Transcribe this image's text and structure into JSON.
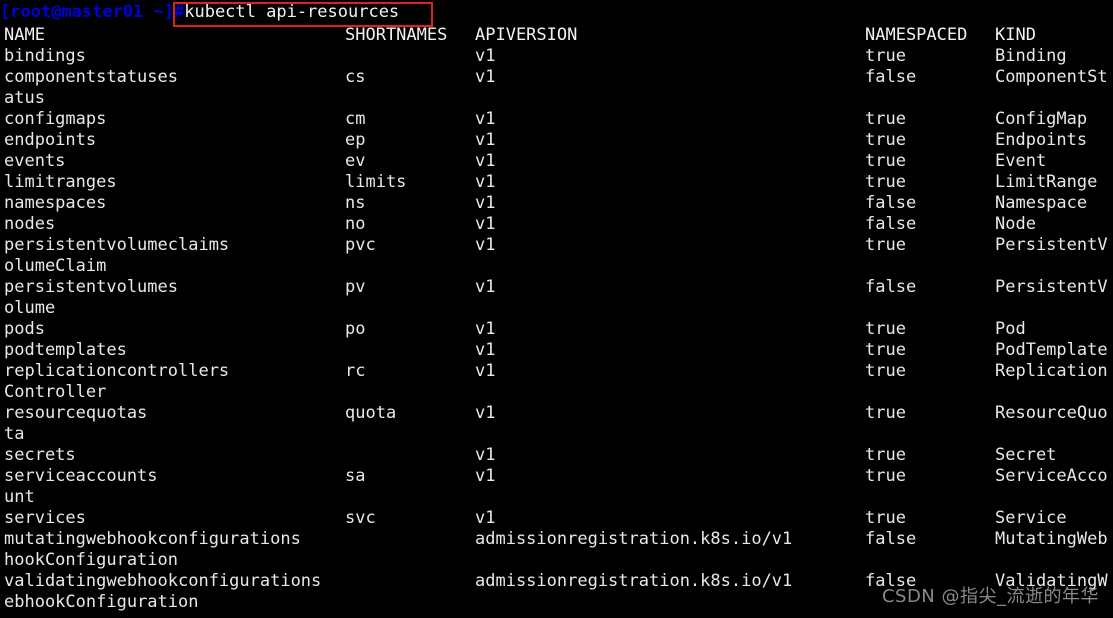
{
  "terminal": {
    "background_color": "#000000",
    "foreground_color": "#e8e8e8",
    "prompt_color": "#0000d8",
    "highlight_box_color": "#e02020",
    "prompt": "[root@master01 ~]#",
    "command": "kubectl api-resources",
    "columns": {
      "name": "NAME",
      "shortnames": "SHORTNAMES",
      "apiversion": "APIVERSION",
      "namespaced": "NAMESPACED",
      "kind": "KIND"
    },
    "rows": [
      {
        "name": "bindings",
        "shortnames": "",
        "apiversion": "v1",
        "namespaced": "true",
        "kind": "Binding"
      },
      {
        "name": "componentstatuses",
        "shortnames": "cs",
        "apiversion": "v1",
        "namespaced": "false",
        "kind": "ComponentSt"
      },
      {
        "name": "atus",
        "shortnames": "",
        "apiversion": "",
        "namespaced": "",
        "kind": ""
      },
      {
        "name": "configmaps",
        "shortnames": "cm",
        "apiversion": "v1",
        "namespaced": "true",
        "kind": "ConfigMap"
      },
      {
        "name": "endpoints",
        "shortnames": "ep",
        "apiversion": "v1",
        "namespaced": "true",
        "kind": "Endpoints"
      },
      {
        "name": "events",
        "shortnames": "ev",
        "apiversion": "v1",
        "namespaced": "true",
        "kind": "Event"
      },
      {
        "name": "limitranges",
        "shortnames": "limits",
        "apiversion": "v1",
        "namespaced": "true",
        "kind": "LimitRange"
      },
      {
        "name": "namespaces",
        "shortnames": "ns",
        "apiversion": "v1",
        "namespaced": "false",
        "kind": "Namespace"
      },
      {
        "name": "nodes",
        "shortnames": "no",
        "apiversion": "v1",
        "namespaced": "false",
        "kind": "Node"
      },
      {
        "name": "persistentvolumeclaims",
        "shortnames": "pvc",
        "apiversion": "v1",
        "namespaced": "true",
        "kind": "PersistentV"
      },
      {
        "name": "olumeClaim",
        "shortnames": "",
        "apiversion": "",
        "namespaced": "",
        "kind": ""
      },
      {
        "name": "persistentvolumes",
        "shortnames": "pv",
        "apiversion": "v1",
        "namespaced": "false",
        "kind": "PersistentV"
      },
      {
        "name": "olume",
        "shortnames": "",
        "apiversion": "",
        "namespaced": "",
        "kind": ""
      },
      {
        "name": "pods",
        "shortnames": "po",
        "apiversion": "v1",
        "namespaced": "true",
        "kind": "Pod"
      },
      {
        "name": "podtemplates",
        "shortnames": "",
        "apiversion": "v1",
        "namespaced": "true",
        "kind": "PodTemplate"
      },
      {
        "name": "replicationcontrollers",
        "shortnames": "rc",
        "apiversion": "v1",
        "namespaced": "true",
        "kind": "Replication"
      },
      {
        "name": "Controller",
        "shortnames": "",
        "apiversion": "",
        "namespaced": "",
        "kind": ""
      },
      {
        "name": "resourcequotas",
        "shortnames": "quota",
        "apiversion": "v1",
        "namespaced": "true",
        "kind": "ResourceQuo"
      },
      {
        "name": "ta",
        "shortnames": "",
        "apiversion": "",
        "namespaced": "",
        "kind": ""
      },
      {
        "name": "secrets",
        "shortnames": "",
        "apiversion": "v1",
        "namespaced": "true",
        "kind": "Secret"
      },
      {
        "name": "serviceaccounts",
        "shortnames": "sa",
        "apiversion": "v1",
        "namespaced": "true",
        "kind": "ServiceAcco"
      },
      {
        "name": "unt",
        "shortnames": "",
        "apiversion": "",
        "namespaced": "",
        "kind": ""
      },
      {
        "name": "services",
        "shortnames": "svc",
        "apiversion": "v1",
        "namespaced": "true",
        "kind": "Service"
      },
      {
        "name": "mutatingwebhookconfigurations",
        "shortnames": "",
        "apiversion": "admissionregistration.k8s.io/v1",
        "namespaced": "false",
        "kind": "MutatingWeb"
      },
      {
        "name": "hookConfiguration",
        "shortnames": "",
        "apiversion": "",
        "namespaced": "",
        "kind": ""
      },
      {
        "name": "validatingwebhookconfigurations",
        "shortnames": "",
        "apiversion": "admissionregistration.k8s.io/v1",
        "namespaced": "false",
        "kind": "ValidatingW"
      },
      {
        "name": "ebhookConfiguration",
        "shortnames": "",
        "apiversion": "",
        "namespaced": "",
        "kind": ""
      }
    ]
  },
  "watermark": {
    "text": "CSDN @指尖_流逝的年华",
    "color": "#8a8a8a"
  }
}
